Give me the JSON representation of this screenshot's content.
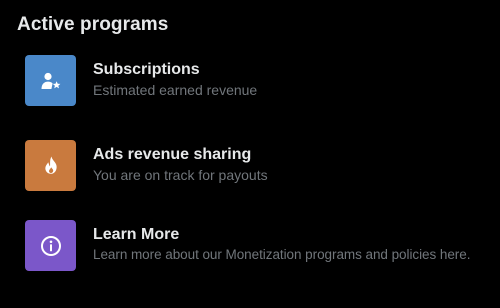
{
  "section": {
    "title": "Active programs"
  },
  "programs": [
    {
      "name": "Subscriptions",
      "description": "Estimated earned revenue",
      "icon": "person-star-icon",
      "color": "#4a88c9"
    },
    {
      "name": "Ads revenue sharing",
      "description": "You are on track for payouts",
      "icon": "flame-icon",
      "color": "#c97a3e"
    },
    {
      "name": "Learn More",
      "description": "Learn more about our Monetization programs and policies here.",
      "icon": "info-icon",
      "color": "#7b57c9"
    }
  ]
}
